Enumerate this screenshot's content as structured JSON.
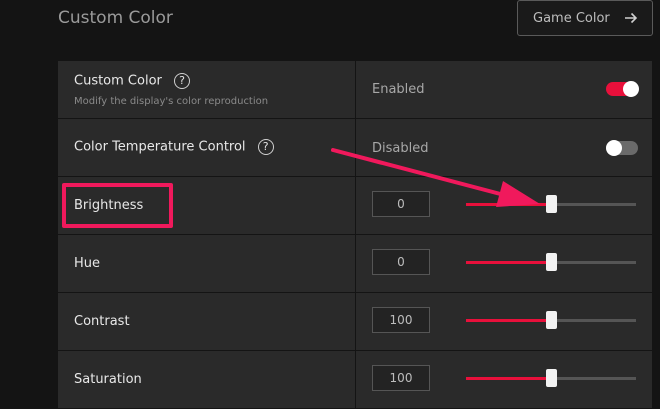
{
  "header": {
    "title": "Custom Color",
    "game_color_button": "Game Color"
  },
  "rows": [
    {
      "label": "Custom Color",
      "subtitle": "Modify the display's color reproduction",
      "state": "Enabled",
      "toggle_on": true
    },
    {
      "label": "Color Temperature Control",
      "state": "Disabled",
      "toggle_on": false
    },
    {
      "label": "Brightness",
      "value": "0",
      "slider_fraction": 0.5
    },
    {
      "label": "Hue",
      "value": "0",
      "slider_fraction": 0.5
    },
    {
      "label": "Contrast",
      "value": "100",
      "slider_fraction": 0.5
    },
    {
      "label": "Saturation",
      "value": "100",
      "slider_fraction": 0.5
    }
  ],
  "colors": {
    "accent": "#e8103b",
    "annotation": "#f0195c"
  },
  "icons": {
    "help": "question-circle-icon",
    "arrow": "arrow-right-icon"
  }
}
